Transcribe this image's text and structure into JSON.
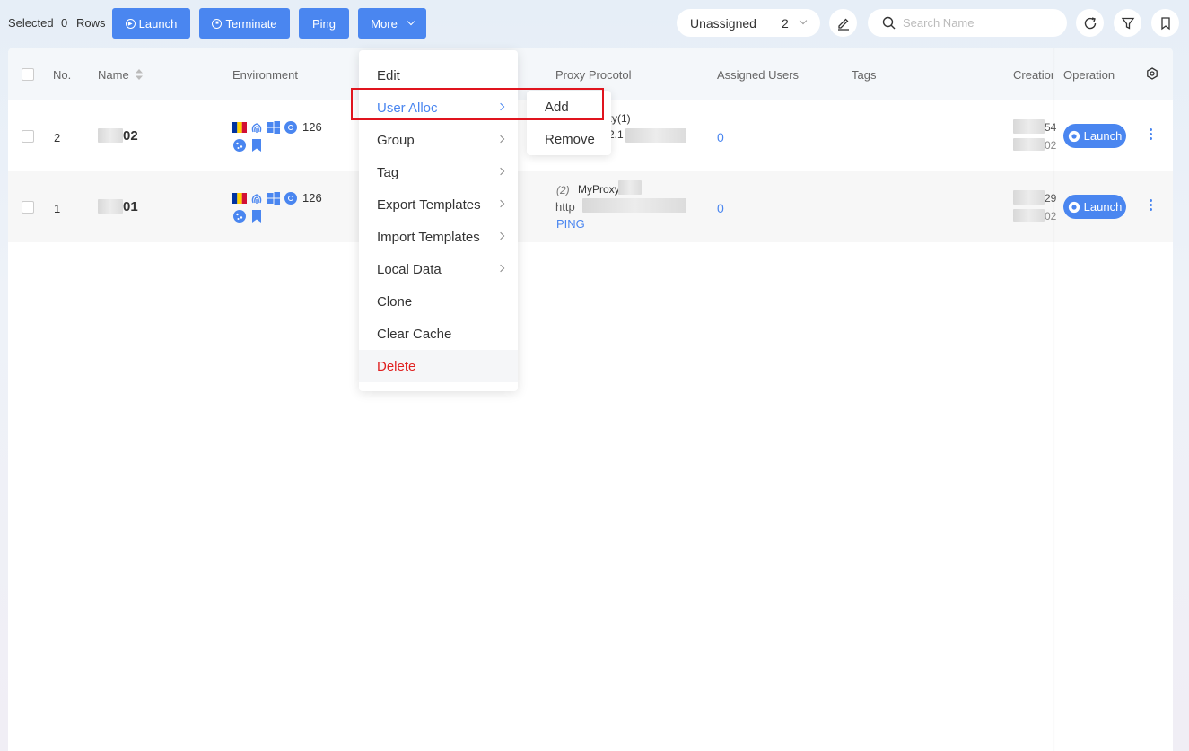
{
  "toolbar": {
    "selected_label": "Selected",
    "selected_count": "0",
    "rows_label": "Rows",
    "launch": "Launch",
    "terminate": "Terminate",
    "ping": "Ping",
    "more": "More",
    "group_select": "Unassigned",
    "group_count": "2",
    "search_placeholder": "Search Name"
  },
  "table": {
    "headers": {
      "no": "No.",
      "name": "Name",
      "environment": "Environment",
      "proxy": "Proxy Procotol",
      "assigned": "Assigned Users",
      "tags": "Tags",
      "creation": "Creation",
      "operation": "Operation"
    },
    "rows": [
      {
        "no": "2",
        "name_suffix": "02",
        "env_count": "126",
        "proxy_line1": "xy(1)",
        "proxy_line2": "2.1",
        "assigned": "0",
        "creation_a": "54",
        "creation_b": "02",
        "launch": "Launch"
      },
      {
        "no": "1",
        "name_suffix": "01",
        "env_count": "126",
        "proxy_index": "(2)",
        "proxy_name": "MyProxy",
        "proxy_type": "http",
        "proxy_ping": "PING",
        "assigned": "0",
        "creation_a": "29",
        "creation_b": "02",
        "launch": "Launch"
      }
    ]
  },
  "menu": {
    "items": [
      "Edit",
      "User Alloc",
      "Group",
      "Tag",
      "Export Templates",
      "Import Templates",
      "Local Data",
      "Clone",
      "Clear Cache",
      "Delete"
    ]
  },
  "submenu": {
    "items": [
      "Add",
      "Remove"
    ]
  },
  "colors": {
    "accent": "#4a86f0",
    "danger": "#e02020",
    "highlight": "#e0141e"
  }
}
